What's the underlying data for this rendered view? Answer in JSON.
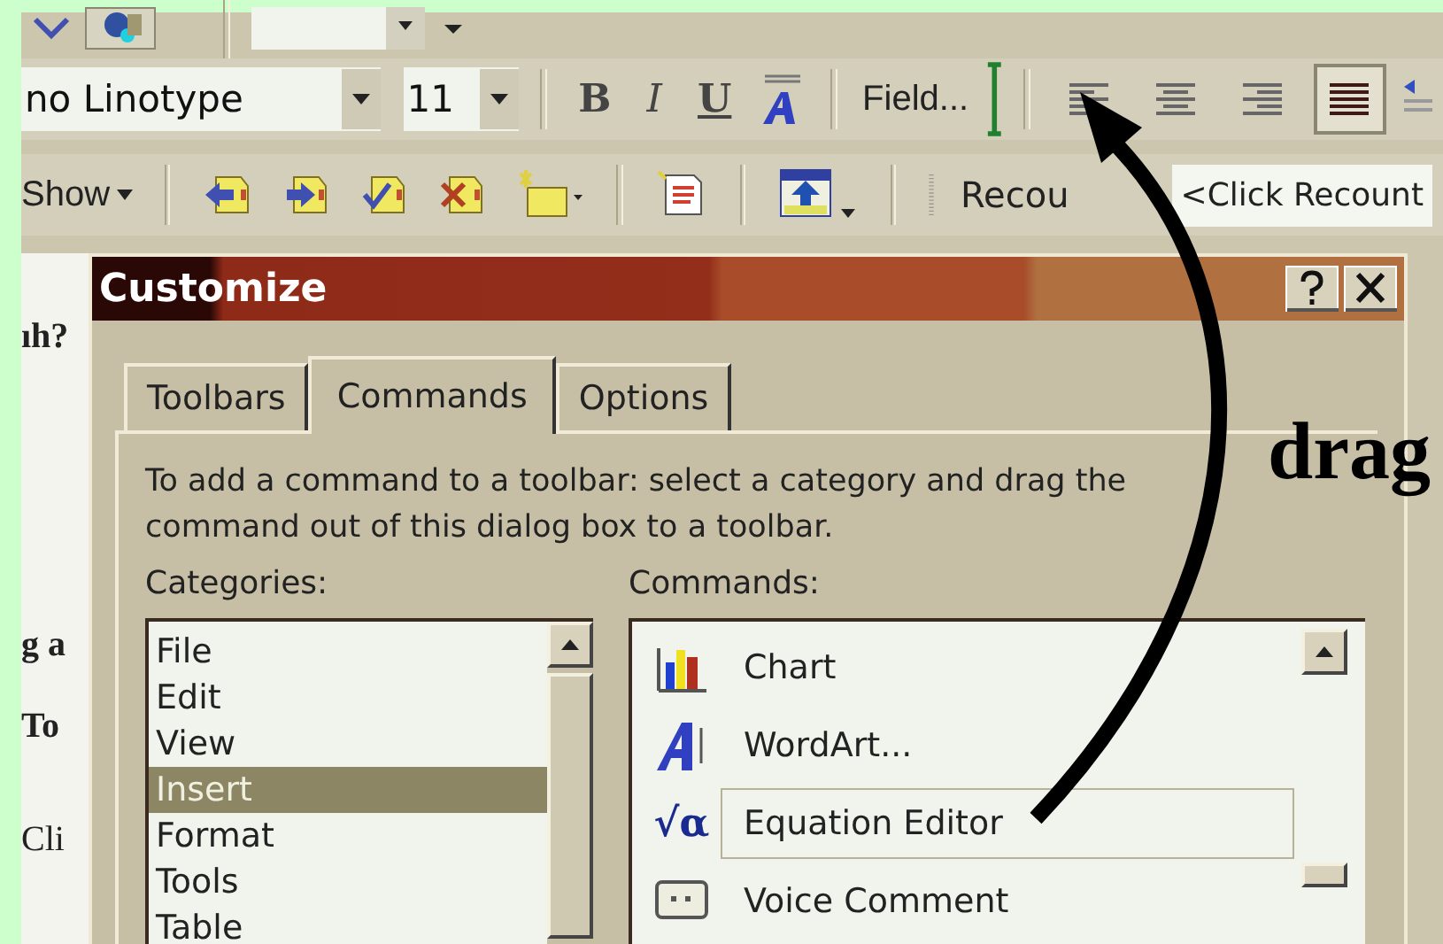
{
  "formatting_toolbar": {
    "font": "no Linotype",
    "size": "11",
    "styles": [
      {
        "kind": "bold",
        "label": "B"
      },
      {
        "kind": "italic",
        "label": "I"
      },
      {
        "kind": "underline",
        "label": "U"
      }
    ],
    "field_button": "Field...",
    "alignments": [
      {
        "kind": "left",
        "selected": false
      },
      {
        "kind": "center",
        "selected": false
      },
      {
        "kind": "right",
        "selected": false
      },
      {
        "kind": "justify",
        "selected": true
      }
    ]
  },
  "reviewing_toolbar": {
    "show_menu": "Show",
    "recount_label": "Recou",
    "recount_field": "<Click Recount"
  },
  "document": {
    "left_fragments": [
      "ıh?",
      "g a",
      "To",
      "Cli"
    ]
  },
  "dialog": {
    "title": "Customize",
    "tabs": [
      {
        "label": "Toolbars",
        "selected": false
      },
      {
        "label": "Commands",
        "selected": true
      },
      {
        "label": "Options",
        "selected": false
      }
    ],
    "description": "To add a command to a toolbar: select a category and drag the command out of this dialog box to a toolbar.",
    "categories_label": "Categories:",
    "categories": [
      {
        "label": "File",
        "selected": false
      },
      {
        "label": "Edit",
        "selected": false
      },
      {
        "label": "View",
        "selected": false
      },
      {
        "label": "Insert",
        "selected": true
      },
      {
        "label": "Format",
        "selected": false
      },
      {
        "label": "Tools",
        "selected": false
      },
      {
        "label": "Table",
        "selected": false
      }
    ],
    "commands_label": "Commands:",
    "commands": [
      {
        "kind": "chart",
        "label": "Chart",
        "selected": false
      },
      {
        "kind": "wordart",
        "label": "WordArt...",
        "selected": false
      },
      {
        "kind": "equation",
        "icon": "√α",
        "label": "Equation Editor",
        "selected": true
      },
      {
        "kind": "comment",
        "label": "Voice Comment",
        "selected": false
      }
    ]
  },
  "annotation": {
    "label": "drag"
  }
}
